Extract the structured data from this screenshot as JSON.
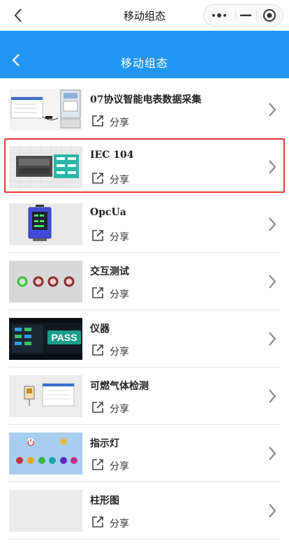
{
  "wx_nav": {
    "title": "移动组态",
    "icons": {
      "back": "chevron-left-icon",
      "more": "more-dots-icon",
      "minimize": "minimize-icon",
      "close": "target-circle-icon"
    }
  },
  "header": {
    "title": "移动组态",
    "background": "#2196f3",
    "back_icon": "chevron-left-icon"
  },
  "list": {
    "selected_index": 1,
    "highlight_color": "#e53935",
    "items": [
      {
        "title": "07协议智能电表数据采集",
        "share_label": "分享",
        "thumb": "meter-dashboard-thumbnail"
      },
      {
        "title": "IEC 104",
        "share_label": "分享",
        "thumb": "plc-module-thumbnail"
      },
      {
        "title": "OpcUa",
        "share_label": "分享",
        "thumb": "device-screen-thumbnail"
      },
      {
        "title": "交互测试",
        "share_label": "分享",
        "thumb": "indicator-lights-thumbnail"
      },
      {
        "title": "仪器",
        "share_label": "分享",
        "thumb": "instrument-panel-thumbnail",
        "thumb_text": "PASS"
      },
      {
        "title": "可燃气体检测",
        "share_label": "分享",
        "thumb": "gas-detection-thumbnail"
      },
      {
        "title": "指示灯",
        "share_label": "分享",
        "thumb": "indicator-lamps-thumbnail"
      },
      {
        "title": "柱形图",
        "share_label": "分享",
        "thumb": "bar-chart-thumbnail"
      }
    ]
  }
}
